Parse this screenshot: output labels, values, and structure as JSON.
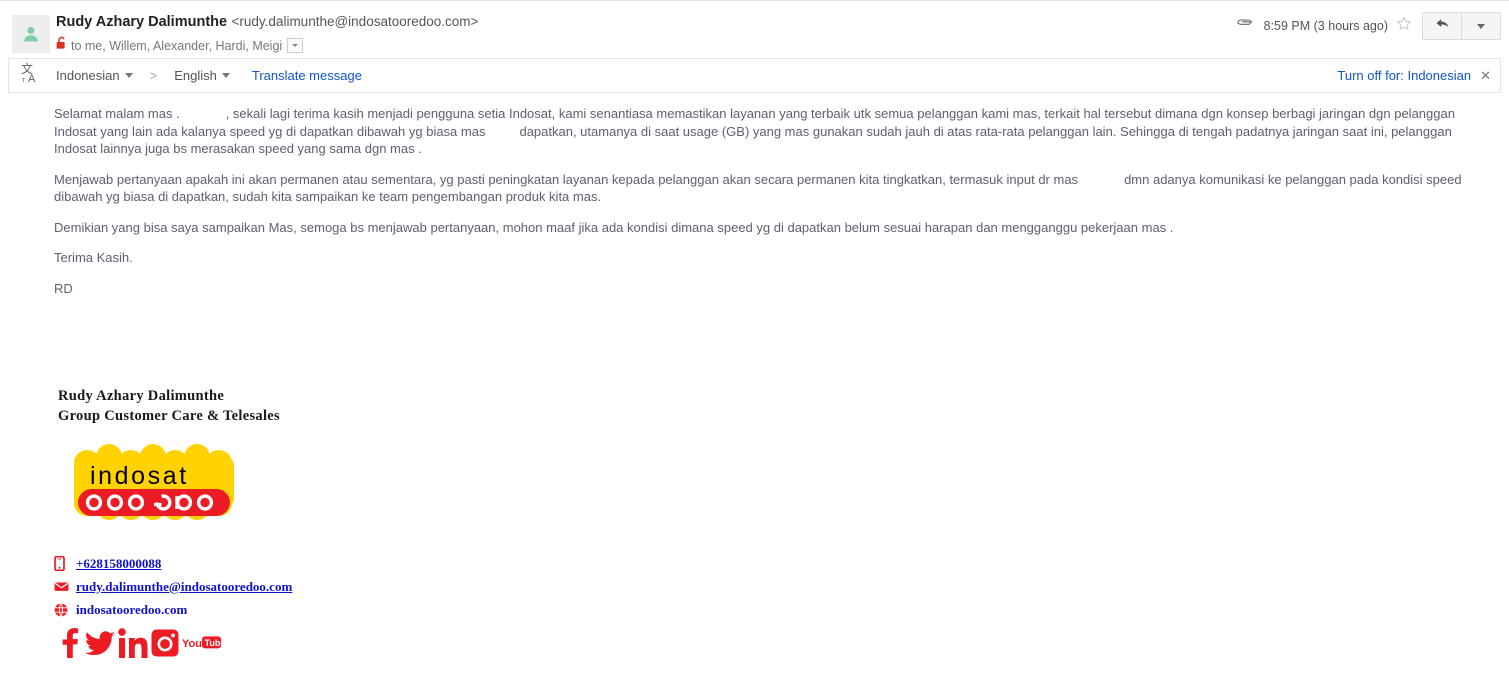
{
  "header": {
    "avatar_icon": "person-avatar-icon",
    "sender_name": "Rudy Azhary Dalimunthe",
    "sender_email": "<rudy.dalimunthe@indosatooredoo.com>",
    "lock_icon": "unlocked-padlock-icon",
    "recipients": "to me, Willem, Alexander, Hardi, Meigi",
    "details_caret_icon": "chevron-down-icon",
    "attachment_icon": "paperclip-icon",
    "timestamp": "8:59 PM (3 hours ago)",
    "star_icon": "star-outline-icon",
    "reply_icon": "reply-arrow-icon",
    "more_icon": "chevron-down-icon"
  },
  "translate_bar": {
    "translate_icon": "translate-icon",
    "source_language": "Indonesian",
    "arrow": ">",
    "target_language": "English",
    "translate_label": "Translate message",
    "turn_off_label": "Turn off for: Indonesian",
    "close_icon": "close-icon"
  },
  "message": {
    "paragraph1_part1": "Selamat malam mas .",
    "paragraph1_part2": ", sekali lagi terima kasih menjadi pengguna setia Indosat, kami senantiasa memastikan layanan yang terbaik utk semua pelanggan kami mas, terkait hal tersebut dimana dgn konsep berbagi jaringan dgn pelanggan Indosat yang lain ada kalanya speed yg di dapatkan dibawah yg biasa mas",
    "paragraph1_part3": "dapatkan, utamanya di saat usage (GB) yang mas gunakan sudah jauh di atas rata-rata pelanggan lain. Sehingga di tengah padatnya jaringan saat ini, pelanggan Indosat lainnya juga bs merasakan speed yang sama dgn mas .",
    "paragraph2_part1": "Menjawab pertanyaan apakah ini akan permanen atau sementara, yg pasti peningkatan layanan kepada pelanggan akan secara permanen kita tingkatkan, termasuk input dr mas",
    "paragraph2_part2": "dmn adanya komunikasi ke pelanggan pada kondisi speed dibawah yg biasa di dapatkan, sudah kita sampaikan ke team pengembangan produk kita mas.",
    "paragraph3": "Demikian yang bisa saya sampaikan Mas, semoga bs menjawab pertanyaan, mohon maaf jika ada kondisi dimana speed yg di dapatkan belum sesuai harapan dan mengganggu pekerjaan mas .",
    "closing": "Terima Kasih.",
    "initials": "RD"
  },
  "signature": {
    "name": "Rudy Azhary Dalimunthe",
    "title": "Group Customer Care & Telesales",
    "logo_alt": "indosat-ooredoo-logo",
    "logo_text_top": "indosat",
    "logo_text_bottom": "ooredoo",
    "contacts": [
      {
        "icon": "mobile-phone-icon",
        "label": "+628158000088",
        "underline": true
      },
      {
        "icon": "envelope-icon",
        "label": "rudy.dalimunthe@indosatooredoo.com",
        "underline": true
      },
      {
        "icon": "globe-icon",
        "label": "indosatooredoo.com",
        "underline": false
      }
    ],
    "social": [
      {
        "icon": "facebook-icon"
      },
      {
        "icon": "twitter-icon"
      },
      {
        "icon": "linkedin-icon"
      },
      {
        "icon": "instagram-icon"
      },
      {
        "icon": "youtube-icon"
      }
    ]
  },
  "colors": {
    "link_blue": "#1155cc",
    "brand_red": "#ed1c24",
    "brand_yellow": "#ffd200",
    "body_text": "#5f5f6e",
    "avatar_green": "#7fcfa6"
  }
}
